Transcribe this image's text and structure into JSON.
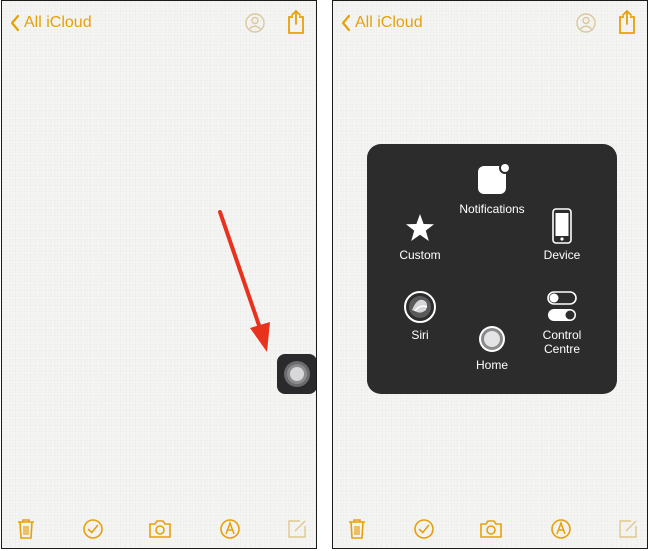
{
  "nav": {
    "back_label": "All iCloud"
  },
  "assistive_menu": {
    "items": [
      {
        "id": "notifications",
        "label": "Notifications",
        "icon": "notifications-icon"
      },
      {
        "id": "custom",
        "label": "Custom",
        "icon": "star-icon"
      },
      {
        "id": "device",
        "label": "Device",
        "icon": "iphone-icon"
      },
      {
        "id": "siri",
        "label": "Siri",
        "icon": "siri-icon"
      },
      {
        "id": "home",
        "label": "Home",
        "icon": "home-button-icon"
      },
      {
        "id": "control_centre",
        "label": "Control\nCentre",
        "icon": "toggles-icon"
      }
    ]
  },
  "toolbar": {
    "icons": [
      "trash-icon",
      "checkmark-circle-icon",
      "camera-icon",
      "pen-circle-icon",
      "compose-icon"
    ]
  },
  "colors": {
    "accent": "#e6a10a",
    "menu_background": "#2c2c2c",
    "arrow": "#e8321e"
  }
}
